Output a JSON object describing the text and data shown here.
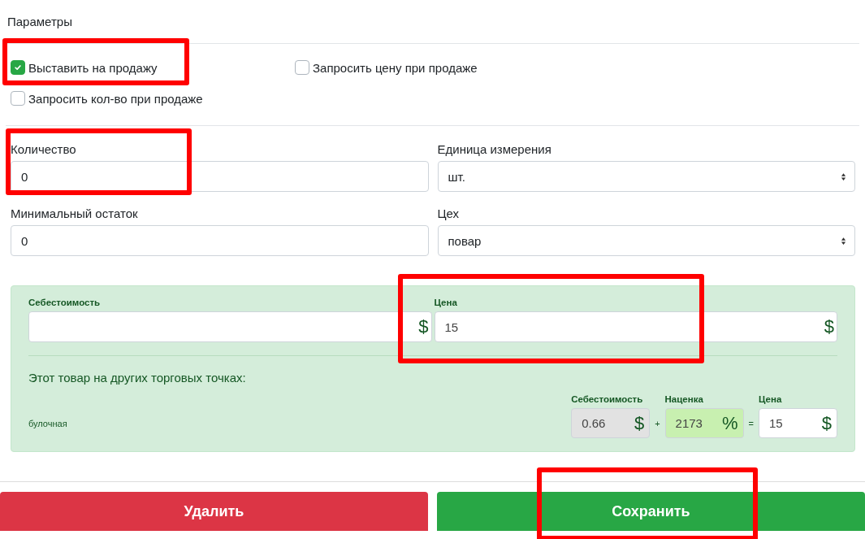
{
  "section_title": "Параметры",
  "checkboxes": [
    {
      "label": "Выставить на продажу",
      "checked": true
    },
    {
      "label": "Запросить цену при продаже",
      "checked": false
    },
    {
      "label": "Запросить кол-во при продаже",
      "checked": false
    }
  ],
  "fields": [
    {
      "kind": "input",
      "label": "Количество",
      "value": "0"
    },
    {
      "kind": "select",
      "label": "Единица измерения",
      "value": "шт."
    },
    {
      "kind": "input",
      "label": "Минимальный остаток",
      "value": "0"
    },
    {
      "kind": "select",
      "label": "Цех",
      "value": "повар"
    }
  ],
  "pricing": {
    "cost": {
      "label": "Себестоимость",
      "unit": "$"
    },
    "price": {
      "label": "Цена",
      "value": "15",
      "unit": "$"
    },
    "other_points_title": "Этот товар на других торговых точках:",
    "points": [
      {
        "name": "булочная",
        "cost": {
          "label": "Себестоимость",
          "value": "0.66",
          "unit": "$"
        },
        "plus": "+",
        "markup": {
          "label": "Наценка",
          "value": "2173",
          "unit": "%"
        },
        "equals": "=",
        "price": {
          "label": "Цена",
          "value": "15",
          "unit": "$"
        }
      }
    ]
  },
  "buttons": [
    {
      "kind": "danger",
      "label": "Удалить"
    },
    {
      "kind": "success",
      "label": "Сохранить"
    }
  ]
}
